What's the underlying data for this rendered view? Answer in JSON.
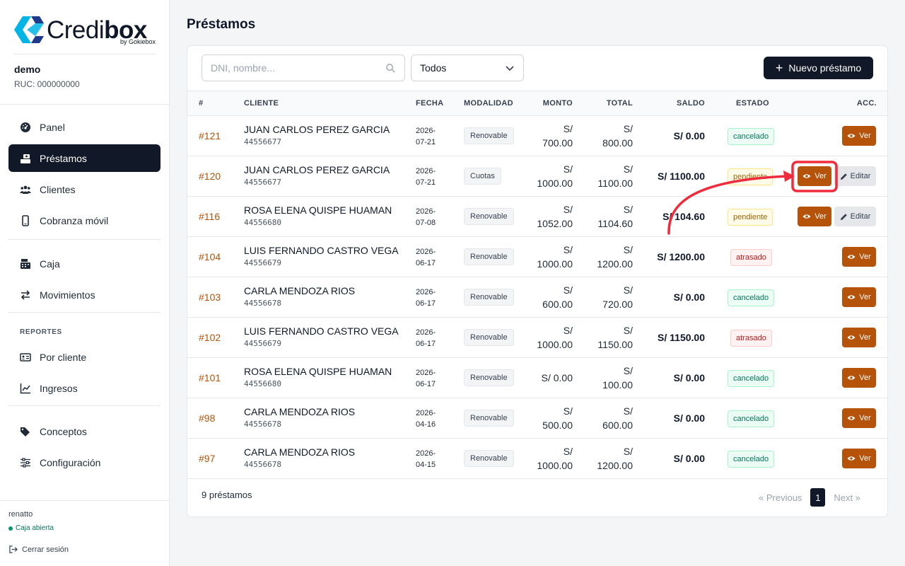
{
  "brand": {
    "name_light": "Credi",
    "name_bold": "box",
    "sub": "by Gokiebox"
  },
  "company": {
    "name": "demo",
    "ruc": "RUC: 000000000"
  },
  "nav": {
    "panel": "Panel",
    "prestamos": "Préstamos",
    "clientes": "Clientes",
    "cobranza": "Cobranza móvil",
    "caja": "Caja",
    "movimientos": "Movimientos",
    "reportes_label": "REPORTES",
    "por_cliente": "Por cliente",
    "ingresos": "Ingresos",
    "conceptos": "Conceptos",
    "configuracion": "Configuración"
  },
  "footer": {
    "user": "renatto",
    "caja_status": "Caja abierta",
    "logout": "Cerrar sesión"
  },
  "page": {
    "title": "Préstamos"
  },
  "toolbar": {
    "search_placeholder": "DNI, nombre...",
    "filter_value": "Todos",
    "new_label": "Nuevo préstamo"
  },
  "table": {
    "headers": {
      "id": "#",
      "cliente": "CLIENTE",
      "fecha": "FECHA",
      "modalidad": "MODALIDAD",
      "monto": "MONTO",
      "total": "TOTAL",
      "saldo": "SALDO",
      "estado": "ESTADO",
      "acc": "ACC."
    },
    "ver_label": "Ver",
    "editar_label": "Editar",
    "rows": [
      {
        "id": "#121",
        "name": "JUAN CARLOS PEREZ GARCIA",
        "dni": "44556677",
        "date_a": "2026-",
        "date_b": "07-21",
        "mod": "Renovable",
        "monto_a": "S/",
        "monto_b": "700.00",
        "total_a": "S/",
        "total_b": "800.00",
        "saldo": "S/ 0.00",
        "estado": "cancelado",
        "edit": false
      },
      {
        "id": "#120",
        "name": "JUAN CARLOS PEREZ GARCIA",
        "dni": "44556677",
        "date_a": "2026-",
        "date_b": "07-21",
        "mod": "Cuotas",
        "monto_a": "S/",
        "monto_b": "1000.00",
        "total_a": "S/",
        "total_b": "1100.00",
        "saldo": "S/ 1100.00",
        "estado": "pendiente",
        "edit": true
      },
      {
        "id": "#116",
        "name": "ROSA ELENA QUISPE HUAMAN",
        "dni": "44556680",
        "date_a": "2026-",
        "date_b": "07-08",
        "mod": "Renovable",
        "monto_a": "S/",
        "monto_b": "1052.00",
        "total_a": "S/",
        "total_b": "1104.60",
        "saldo": "S/ 104.60",
        "estado": "pendiente",
        "edit": true
      },
      {
        "id": "#104",
        "name": "LUIS FERNANDO CASTRO VEGA",
        "dni": "44556679",
        "date_a": "2026-",
        "date_b": "06-17",
        "mod": "Renovable",
        "monto_a": "S/",
        "monto_b": "1000.00",
        "total_a": "S/",
        "total_b": "1200.00",
        "saldo": "S/ 1200.00",
        "estado": "atrasado",
        "edit": false
      },
      {
        "id": "#103",
        "name": "CARLA MENDOZA RIOS",
        "dni": "44556678",
        "date_a": "2026-",
        "date_b": "06-17",
        "mod": "Renovable",
        "monto_a": "S/",
        "monto_b": "600.00",
        "total_a": "S/",
        "total_b": "720.00",
        "saldo": "S/ 0.00",
        "estado": "cancelado",
        "edit": false
      },
      {
        "id": "#102",
        "name": "LUIS FERNANDO CASTRO VEGA",
        "dni": "44556679",
        "date_a": "2026-",
        "date_b": "06-17",
        "mod": "Renovable",
        "monto_a": "S/",
        "monto_b": "1000.00",
        "total_a": "S/",
        "total_b": "1150.00",
        "saldo": "S/ 1150.00",
        "estado": "atrasado",
        "edit": false
      },
      {
        "id": "#101",
        "name": "ROSA ELENA QUISPE HUAMAN",
        "dni": "44556680",
        "date_a": "2026-",
        "date_b": "06-17",
        "mod": "Renovable",
        "monto_a": "S/ 0.00",
        "monto_b": "",
        "total_a": "S/",
        "total_b": "100.00",
        "saldo": "S/ 0.00",
        "estado": "cancelado",
        "edit": false
      },
      {
        "id": "#98",
        "name": "CARLA MENDOZA RIOS",
        "dni": "44556678",
        "date_a": "2026-",
        "date_b": "04-16",
        "mod": "Renovable",
        "monto_a": "S/",
        "monto_b": "500.00",
        "total_a": "S/",
        "total_b": "600.00",
        "saldo": "S/ 0.00",
        "estado": "cancelado",
        "edit": false
      },
      {
        "id": "#97",
        "name": "CARLA MENDOZA RIOS",
        "dni": "44556678",
        "date_a": "2026-",
        "date_b": "04-15",
        "mod": "Renovable",
        "monto_a": "S/",
        "monto_b": "1000.00",
        "total_a": "S/",
        "total_b": "1200.00",
        "saldo": "S/ 0.00",
        "estado": "cancelado",
        "edit": false
      }
    ]
  },
  "summary": {
    "count": "9 préstamos"
  },
  "pagination": {
    "prev": "« Previous",
    "current": "1",
    "next": "Next »"
  },
  "colors": {
    "accent": "#b45309",
    "dark": "#111827",
    "highlight": "#ef2b3c"
  },
  "icons": {
    "search": "search-icon",
    "chevron": "chevron-down-icon",
    "eye": "eye-icon",
    "pencil": "pencil-icon"
  }
}
